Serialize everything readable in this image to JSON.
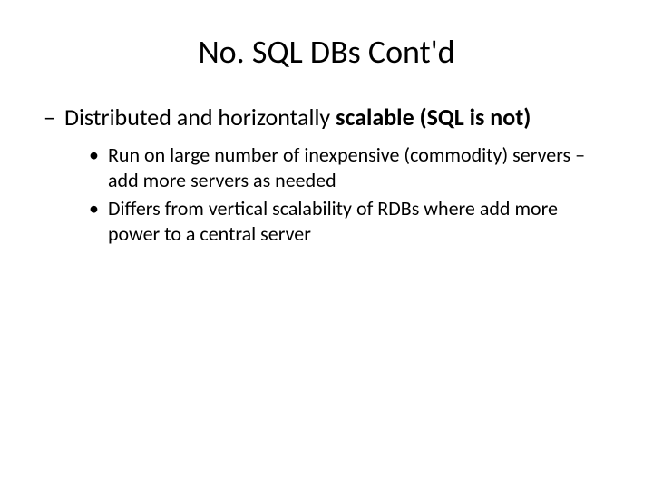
{
  "title": "No. SQL DBs Cont'd",
  "level1": {
    "dash": "–",
    "text_a": "Distributed and horizontally ",
    "text_b": "scalable (SQL is not)"
  },
  "bullets": [
    {
      "marker": "•",
      "text": "Run on large number of inexpensive (commodity) servers – add more servers as needed"
    },
    {
      "marker": "•",
      "text": "Differs from  vertical scalability of RDBs where add more power to a central server"
    }
  ]
}
